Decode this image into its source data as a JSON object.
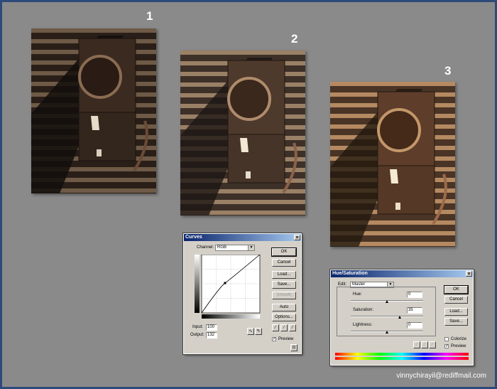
{
  "steps": {
    "one": "1",
    "two": "2",
    "three": "3"
  },
  "photos": [
    {
      "label": "1",
      "brightness": "dark"
    },
    {
      "label": "2",
      "brightness": "medium"
    },
    {
      "label": "3",
      "brightness": "bright"
    }
  ],
  "curves": {
    "title": "Curves",
    "close_label": "×",
    "channel_label": "Channel:",
    "channel_value": "RGB",
    "input_label": "Input:",
    "input_value": "100",
    "output_label": "Output:",
    "output_value": "132",
    "buttons": {
      "ok": "OK",
      "cancel": "Cancel",
      "load": "Load...",
      "save": "Save...",
      "smooth": "Smooth",
      "auto": "Auto",
      "options": "Options..."
    },
    "preview_label": "Preview",
    "preview_checked": true
  },
  "hue_saturation": {
    "title": "Hue/Saturation",
    "close_label": "×",
    "edit_label": "Edit:",
    "edit_value": "Master",
    "hue_label": "Hue:",
    "hue_value": "0",
    "saturation_label": "Saturation:",
    "saturation_value": "35",
    "lightness_label": "Lightness:",
    "lightness_value": "0",
    "buttons": {
      "ok": "OK",
      "cancel": "Cancel",
      "load": "Load...",
      "save": "Save..."
    },
    "colorize_label": "Colorize",
    "colorize_checked": false,
    "preview_label": "Preview",
    "preview_checked": true
  },
  "credit": "vinnychirayil@rediffmail.com"
}
